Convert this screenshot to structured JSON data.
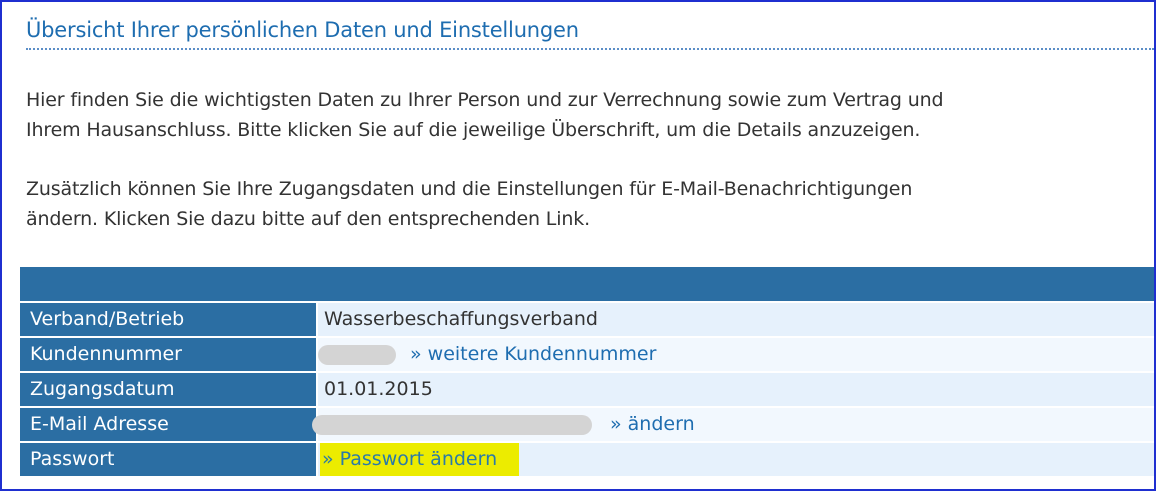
{
  "page": {
    "title": "Übersicht Ihrer persönlichen Daten und Einstellungen",
    "paragraph1_line1": "Hier finden Sie die wichtigsten Daten zu Ihrer Person und zur Verrechnung sowie zum Vertrag und",
    "paragraph1_line2": "Ihrem Hausanschluss. Bitte klicken Sie auf die jeweilige Überschrift, um die Details anzuzeigen.",
    "paragraph2_line1": "Zusätzlich können Sie Ihre Zugangsdaten und die Einstellungen für E-Mail-Benachrichtigungen",
    "paragraph2_line2": "ändern. Klicken Sie dazu bitte auf den entsprechenden Link."
  },
  "table": {
    "rows": [
      {
        "label": "Verband/Betrieb",
        "value": "Wasserbeschaffungsverband"
      },
      {
        "label": "Kundennummer",
        "link": "» weitere Kundennummer"
      },
      {
        "label": "Zugangsdatum",
        "value": "01.01.2015"
      },
      {
        "label": "E-Mail Adresse",
        "link": "» ändern"
      },
      {
        "label": "Passwort",
        "link": "» Passwort ändern"
      }
    ]
  },
  "colors": {
    "header_blue": "#2b6ea3",
    "link_blue": "#1e6db0",
    "highlight_yellow": "#ecec00",
    "frame_border": "#1f2fd0"
  }
}
